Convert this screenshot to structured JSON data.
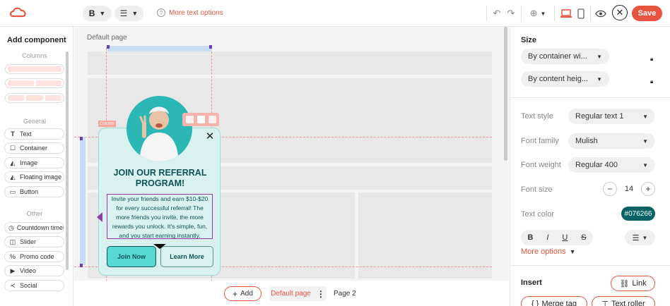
{
  "toolbar": {
    "bold_label": "B",
    "more_text_options": "More text options",
    "save_label": "Save"
  },
  "left_panel": {
    "title": "Add component",
    "section_columns": "Columns",
    "section_general": "General",
    "section_other": "Other",
    "general_items": [
      {
        "label": "Text",
        "icon": "T"
      },
      {
        "label": "Container",
        "icon": "☐"
      },
      {
        "label": "Image",
        "icon": "◭"
      },
      {
        "label": "Floating image",
        "icon": "◭"
      },
      {
        "label": "Button",
        "icon": "▭"
      }
    ],
    "other_items": [
      {
        "label": "Countdown timer",
        "icon": "◷"
      },
      {
        "label": "Slider",
        "icon": "◫"
      },
      {
        "label": "Promo code",
        "icon": "%"
      },
      {
        "label": "Video",
        "icon": "▶"
      },
      {
        "label": "Social",
        "icon": "≺"
      }
    ]
  },
  "canvas": {
    "page_label": "Default page",
    "column_tag": "Column",
    "popup": {
      "title_line1": "JOIN OUR REFERRAL",
      "title_line2": "PROGRAM!",
      "body_lines": [
        "Invite your friends and earn $10-$20",
        "for every successful referral! The",
        "more friends you invite, the more",
        "rewards you unlock. It's simple, fun,",
        "and you start earning instantly."
      ],
      "join_label": "Join Now",
      "learn_label": "Learn More"
    }
  },
  "bottom_bar": {
    "add_label": "Add",
    "pages": [
      "Default page",
      "Page 2"
    ]
  },
  "right_panel": {
    "size_title": "Size",
    "width_select": "By container wi...",
    "height_select": "By content heig...",
    "text_style_label": "Text style",
    "text_style_value": "Regular text 1",
    "font_family_label": "Font family",
    "font_family_value": "Mulish",
    "font_weight_label": "Font weight",
    "font_weight_value": "Regular 400",
    "font_size_label": "Font size",
    "font_size_value": "14",
    "text_color_label": "Text color",
    "text_color_value": "#076266",
    "style_buttons": [
      "B",
      "I",
      "U",
      "S"
    ],
    "more_options": "More options",
    "insert_title": "Insert",
    "link_label": "Link",
    "merge_tag_label": "Merge tag",
    "text_roller_label": "Text roller"
  },
  "colors": {
    "accent": "#e8543f",
    "text_color": "#076266",
    "popup_bg": "#d9f2ef"
  }
}
